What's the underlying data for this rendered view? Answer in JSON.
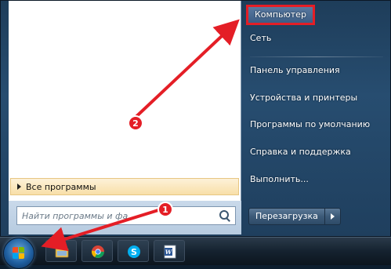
{
  "start_menu": {
    "all_programs_label": "Все программы",
    "search_placeholder": "Найти программы и фа",
    "right_items": [
      {
        "label": "Компьютер"
      },
      {
        "label": "Сеть"
      },
      {
        "label": "Панель управления"
      },
      {
        "label": "Устройства и принтеры"
      },
      {
        "label": "Программы по умолчанию"
      },
      {
        "label": "Справка и поддержка"
      },
      {
        "label": "Выполнить..."
      }
    ],
    "shutdown_label": "Перезагрузка"
  },
  "taskbar": {
    "apps": [
      {
        "name": "windows-explorer"
      },
      {
        "name": "google-chrome"
      },
      {
        "name": "skype"
      },
      {
        "name": "microsoft-word"
      }
    ]
  },
  "annotations": {
    "step1": "1",
    "step2": "2",
    "arrow_color": "#e41e26"
  }
}
